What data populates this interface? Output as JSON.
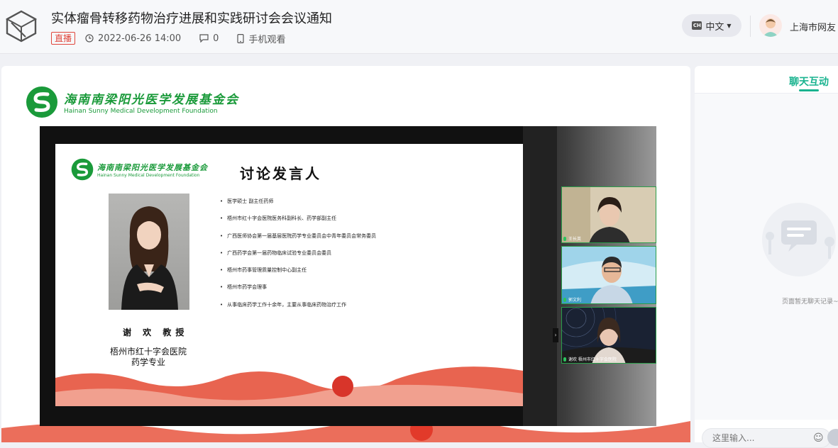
{
  "header": {
    "title": "实体瘤骨转移药物治疗进展和实践研讨会会议通知",
    "live_badge": "直播",
    "datetime": "2022-06-26 14:00",
    "comment_count": "0",
    "mobile_label": "手机观看",
    "lang_code": "CH",
    "lang_label": "中文",
    "user_name": "上海市网友"
  },
  "player": {
    "foundation_cn": "海南南梁阳光医学发展基金会",
    "foundation_en": "Hainan Sunny Medical Development Foundation",
    "slide": {
      "title": "讨论发言人",
      "speaker_name": "谢 欢 教授",
      "speaker_org_line1": "梧州市红十字会医院",
      "speaker_org_line2": "药学专业",
      "bullets": [
        "医学硕士 副主任药师",
        "梧州市红十字会医院医务科副科长、药学部副主任",
        "广西医师协会第一届基层医院药学专业委员会中青年委员会常务委员",
        "广西药学会第一届药物临床试验专业委员会委员",
        "梧州市药事管理质量控制中心副主任",
        "梧州市药学会理事",
        "从事临床药学工作十余年，主要从事临床药物治疗工作"
      ]
    },
    "tiles": [
      {
        "label": "王长英"
      },
      {
        "label": "郭文利"
      },
      {
        "label": "谢欢 梧州市红十字会医院"
      }
    ]
  },
  "chat": {
    "tab_label": "聊天互动",
    "empty_text": "页面暂无聊天记录~",
    "input_placeholder": "这里输入..."
  },
  "colors": {
    "accent_green": "#19b38f",
    "live_red": "#e0463c",
    "foundation_green": "#1a9a3a"
  }
}
